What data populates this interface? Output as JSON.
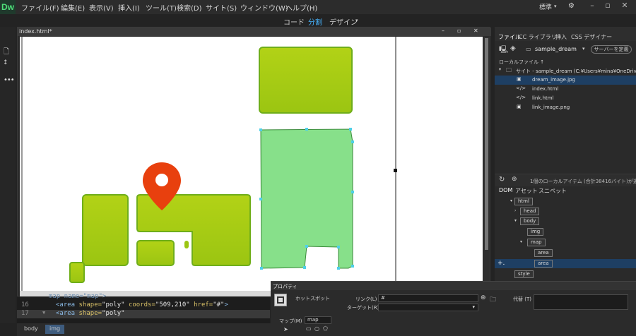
{
  "app": {
    "logo": "Dw"
  },
  "menu": [
    "ファイル(F)",
    "編集(E)",
    "表示(V)",
    "挿入(I)",
    "ツール(T)",
    "検索(D)",
    "サイト(S)",
    "ウィンドウ(W)",
    "ヘルプ(H)"
  ],
  "workspace": {
    "label": "標準"
  },
  "view_switcher": {
    "code": "コード",
    "split": "分割",
    "design": "デザイン"
  },
  "document": {
    "tab": "index.html*"
  },
  "code": {
    "lines": [
      {
        "num": "",
        "text": "<map name=\"map\">"
      },
      {
        "num": "16",
        "text": "<area shape=\"poly\" coords=\"509,210\" href=\"#\">"
      },
      {
        "num": "17",
        "text": "<area shape=\"poly\""
      }
    ],
    "line16": {
      "num": "16",
      "tag_open": "<area ",
      "attr1": "shape=",
      "val1": "\"poly\"",
      "attr2": " coords=",
      "val2": "\"509,210\"",
      "attr3": " href=",
      "val3": "\"#\"",
      "tag_close": ">"
    },
    "line17": {
      "num": "17",
      "tag_open": "<area ",
      "attr1": "shape=",
      "val1": "\"poly\""
    },
    "line15": {
      "text": "map name=\"map\">"
    }
  },
  "status": {
    "crumbs": [
      "body",
      "img"
    ]
  },
  "panel": {
    "tabs": [
      "ファイル",
      "CC ライブラリ",
      "挿入",
      "CSS デザイナー"
    ],
    "site_select": "sample_dream",
    "define_server": "サーバーを定義",
    "local_files_label": "ローカルファイル ↑",
    "site_root": "サイト - sample_dream (C:¥Users¥mina¥OneDriv...",
    "files": [
      "dream_image.jpg",
      "index.html",
      "link.html",
      "link_image.png"
    ],
    "status_text": "1個のローカルアイテム (合計38416バイト)が選...",
    "dom_tabs": [
      "DOM",
      "アセット",
      "スニペット"
    ],
    "dom_nodes": [
      "html",
      "head",
      "body",
      "img",
      "map",
      "area",
      "area",
      "style"
    ]
  },
  "properties": {
    "title": "プロパティ",
    "hotspot": "ホットスポット",
    "link_label": "リンク(L)",
    "link_value": "#",
    "target_label": "ターゲット(R)",
    "alt_label": "代替 (T)",
    "map_label": "マップ(M)",
    "map_value": "map"
  },
  "colors": {
    "accent_green": "#a8cb14",
    "hotspot_fill": "#87e08a",
    "pin_red": "#e8400e",
    "selection_blue": "#1e3f63"
  }
}
